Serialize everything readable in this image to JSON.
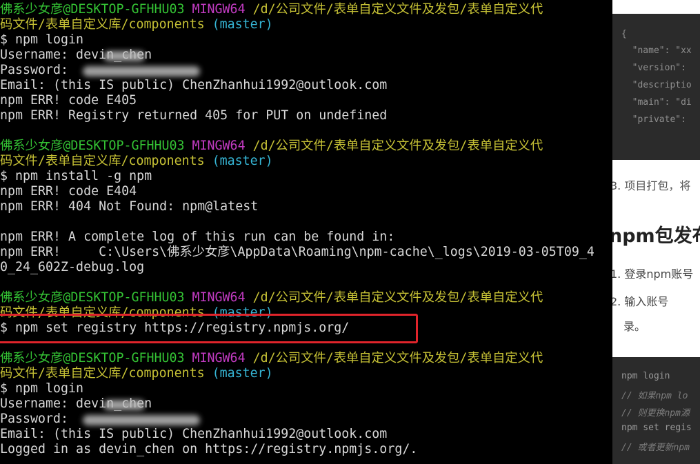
{
  "terminal": {
    "prompt": {
      "user_host": "佛系少女彦@DESKTOP-GFHHU03",
      "shell": "MINGW64",
      "path_line1": "/d/公司文件/表单自定义文件及发包/表单自定义代",
      "path_line2": "码文件/表单自定义库/components",
      "branch": "(master)"
    },
    "lines": {
      "cmd_login": "$ npm login",
      "username_1": "Username: devin_chen",
      "password_label": "Password: ",
      "email": "Email: (this IS public) ChenZhanhui1992@outlook.com",
      "err_code_405": "npm ERR! code E405",
      "err_405_msg": "npm ERR! Registry returned 405 for PUT on undefined",
      "cmd_install": "$ npm install -g npm",
      "err_code_404": "npm ERR! code E404",
      "err_404_msg": "npm ERR! 404 Not Found: npm@latest",
      "err_log_intro": "npm ERR! A complete log of this run can be found in:",
      "err_log_path_1": "npm ERR!     C:\\Users\\佛系少女彦\\AppData\\Roaming\\npm-cache\\_logs\\2019-03-05T09_4",
      "err_log_path_2": "0_24_602Z-debug.log",
      "cmd_set_registry": "$ npm set registry https://registry.npmjs.org/",
      "logged_in": "Logged in as devin_chen on https://registry.npmjs.org/."
    }
  },
  "background_page": {
    "code_snippet_1": [
      "{",
      "  \"name\": \"xx",
      "  \"version\":",
      "  \"descriptio",
      "  \"main\": \"di",
      "  \"private\":"
    ],
    "step3": "3. 项目打包，将",
    "heading": "npm包发布",
    "item1": "1. 登录npm账号",
    "item2": "2. 输入账号",
    "item3": "录。",
    "code_snippet_2": [
      "npm login",
      "// 如果npm lo",
      "// 则更换npm源",
      "npm set regis",
      "// 或者更新npm"
    ]
  },
  "colors": {
    "user_host": "#34c334",
    "shell": "#c33bc3",
    "path": "#c6c135",
    "branch": "#36b6d6",
    "highlight_box": "#e0242b"
  }
}
